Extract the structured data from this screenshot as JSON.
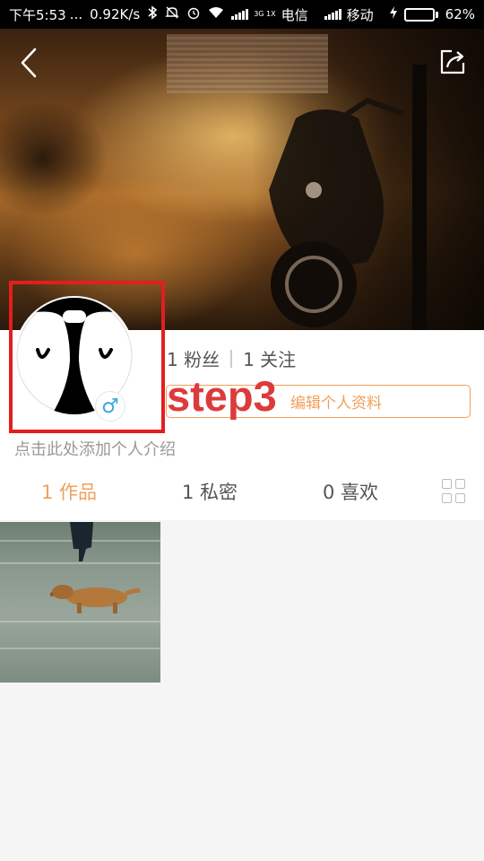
{
  "status_bar": {
    "time": "下午5:53",
    "dots": "...",
    "speed": "0.92K/s",
    "network_type": "3G 1X",
    "carrier1": "电信",
    "carrier2": "移动",
    "battery": "62%",
    "battery_level": 0.62,
    "battery_color": "#5fd42a"
  },
  "header": {
    "back_icon": "chevron-left-icon",
    "share_icon": "share-icon"
  },
  "profile": {
    "followers": "1 粉丝",
    "following": "1 关注",
    "edit_button": "编辑个人资料",
    "intro_placeholder": "点击此处添加个人介绍",
    "gender_icon": "male-symbol-icon",
    "gender_glyph": "♂",
    "gender_color": "#3aa7e0"
  },
  "annotation": {
    "label": "step3",
    "color": "#e31e1e"
  },
  "tabs": [
    {
      "label": "1 作品",
      "active": true
    },
    {
      "label": "1 私密",
      "active": false
    },
    {
      "label": "0 喜欢",
      "active": false
    }
  ],
  "colors": {
    "accent": "#f0a05a",
    "text": "#555555",
    "muted": "#999999"
  }
}
